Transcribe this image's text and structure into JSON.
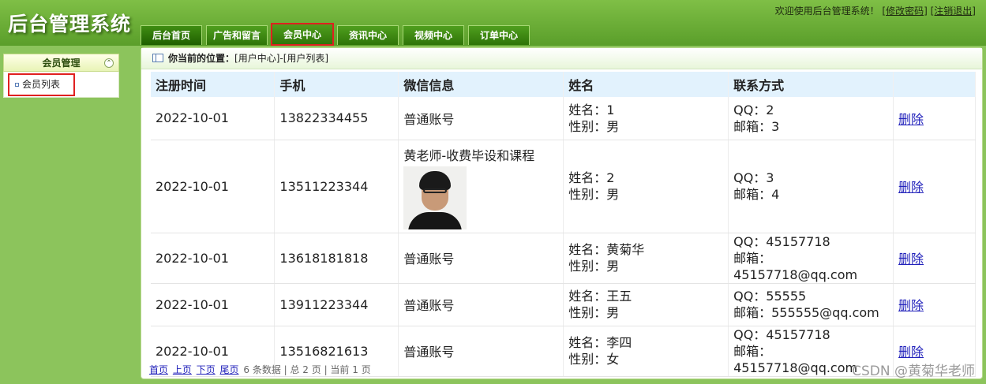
{
  "header": {
    "app_title": "后台管理系统",
    "welcome_text": "欢迎使用后台管理系统！",
    "change_password": "[修改密码]",
    "logout": "[注销退出]",
    "tabs": [
      "后台首页",
      "广告和留言",
      "会员中心",
      "资讯中心",
      "视频中心",
      "订单中心"
    ]
  },
  "sidebar": {
    "section_title": "会员管理",
    "items": [
      {
        "label": "会员列表"
      }
    ]
  },
  "breadcrumb": {
    "label": "你当前的位置：",
    "path": "[用户中心]-[用户列表]"
  },
  "table": {
    "headers": [
      "注册时间",
      "手机",
      "微信信息",
      "姓名",
      "联系方式",
      ""
    ],
    "rows": [
      {
        "reg_time": "2022-10-01",
        "phone": "13822334455",
        "wechat": "普通账号",
        "name_line": "姓名：1",
        "gender_line": "性别：男",
        "qq_line": "QQ：2",
        "email_line": "邮箱：3",
        "action": "删除"
      },
      {
        "reg_time": "2022-10-01",
        "phone": "13511223344",
        "wechat": "黄老师-收费毕设和课程",
        "name_line": "姓名：2",
        "gender_line": "性别：男",
        "qq_line": "QQ：3",
        "email_line": "邮箱：4",
        "action": "删除"
      },
      {
        "reg_time": "2022-10-01",
        "phone": "13618181818",
        "wechat": "普通账号",
        "name_line": "姓名：黄菊华",
        "gender_line": "性别：男",
        "qq_line": "QQ：45157718",
        "email_line": "邮箱：45157718@qq.com",
        "action": "删除"
      },
      {
        "reg_time": "2022-10-01",
        "phone": "13911223344",
        "wechat": "普通账号",
        "name_line": "姓名：王五",
        "gender_line": "性别：男",
        "qq_line": "QQ：55555",
        "email_line": "邮箱：555555@qq.com",
        "action": "删除"
      },
      {
        "reg_time": "2022-10-01",
        "phone": "13516821613",
        "wechat": "普通账号",
        "name_line": "姓名：李四",
        "gender_line": "性别：女",
        "qq_line": "QQ：45157718",
        "email_line": "邮箱：45157718@qq.com",
        "action": "删除"
      }
    ]
  },
  "pager": {
    "first": "首页",
    "prev": "上页",
    "next": "下页",
    "last": "尾页",
    "summary": "6 条数据 | 总 2 页 | 当前 1 页"
  },
  "watermark": "CSDN @黄菊华老师",
  "colors": {
    "accent": "#e02020",
    "header_green": "#5a9e2a",
    "table_header": "#e2f2fd"
  }
}
